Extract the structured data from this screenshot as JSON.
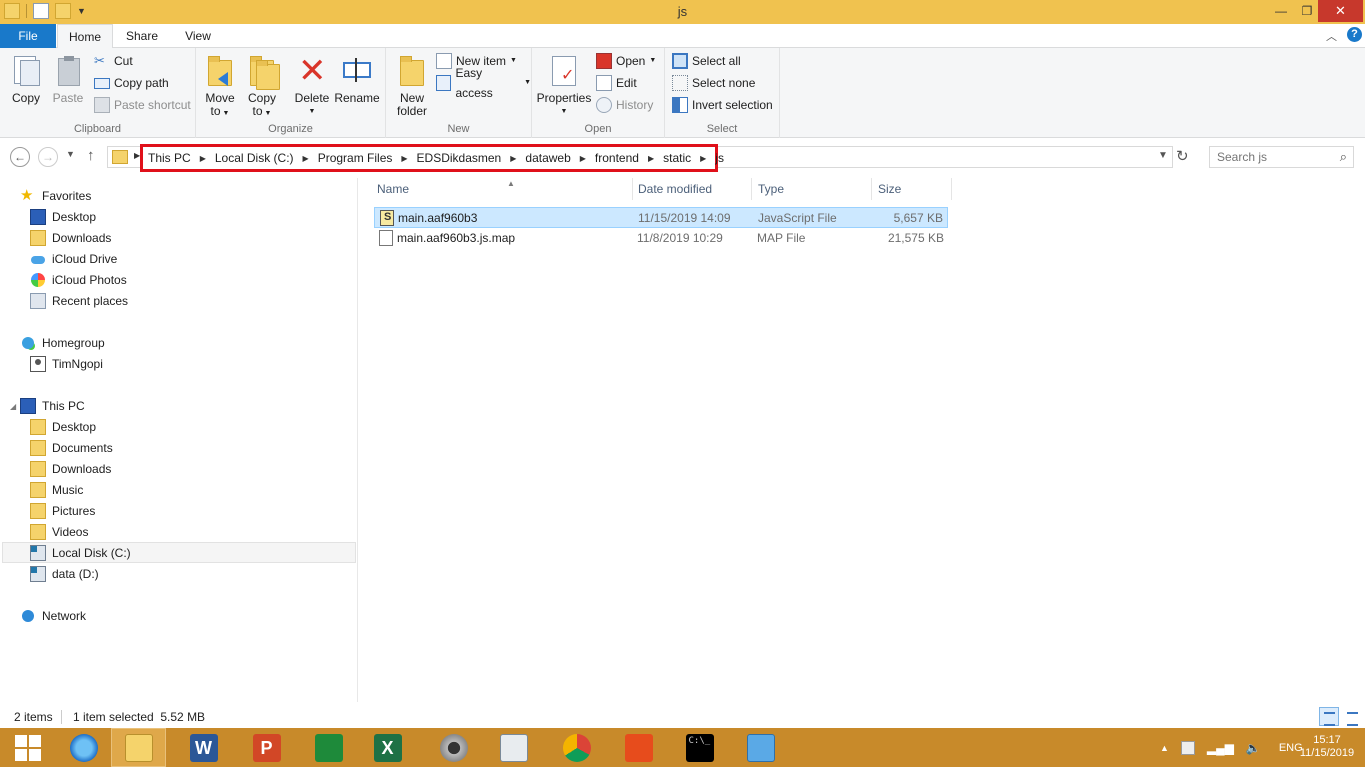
{
  "window": {
    "title": "js"
  },
  "ribbon": {
    "tabs": [
      "File",
      "Home",
      "Share",
      "View"
    ],
    "clipboard": {
      "label": "Clipboard",
      "copy": "Copy",
      "paste": "Paste",
      "cut": "Cut",
      "copy_path": "Copy path",
      "paste_shortcut": "Paste shortcut"
    },
    "organize": {
      "label": "Organize",
      "move_to_1": "Move",
      "move_to_2": "to",
      "copy_to_1": "Copy",
      "copy_to_2": "to",
      "delete": "Delete",
      "rename": "Rename"
    },
    "new": {
      "label": "New",
      "new_folder_1": "New",
      "new_folder_2": "folder",
      "new_item": "New item",
      "easy_access": "Easy access"
    },
    "open": {
      "label": "Open",
      "properties": "Properties",
      "open": "Open",
      "edit": "Edit",
      "history": "History"
    },
    "select": {
      "label": "Select",
      "select_all": "Select all",
      "select_none": "Select none",
      "invert": "Invert selection"
    }
  },
  "address": {
    "crumbs": [
      "This PC",
      "Local Disk (C:)",
      "Program Files",
      "EDSDikdasmen",
      "dataweb",
      "frontend",
      "static",
      "js"
    ],
    "highlight_color": "#e0101a"
  },
  "search": {
    "placeholder": "Search js"
  },
  "navpane": {
    "favorites": "Favorites",
    "fav_items": [
      "Desktop",
      "Downloads",
      "iCloud Drive",
      "iCloud Photos",
      "Recent places"
    ],
    "homegroup": "Homegroup",
    "home_items": [
      "TimNgopi"
    ],
    "thispc": "This PC",
    "pc_items": [
      "Desktop",
      "Documents",
      "Downloads",
      "Music",
      "Pictures",
      "Videos",
      "Local Disk (C:)",
      "data (D:)"
    ],
    "network": "Network"
  },
  "columns": {
    "name": "Name",
    "date": "Date modified",
    "type": "Type",
    "size": "Size"
  },
  "files": [
    {
      "name": "main.aaf960b3",
      "date": "11/15/2019 14:09",
      "type": "JavaScript File",
      "size": "5,657 KB",
      "selected": true
    },
    {
      "name": "main.aaf960b3.js.map",
      "date": "11/8/2019 10:29",
      "type": "MAP File",
      "size": "21,575 KB",
      "selected": false
    }
  ],
  "status": {
    "count": "2 items",
    "selection": "1 item selected  5.52 MB"
  },
  "taskbar": {
    "lang": "ENG",
    "time": "15:17",
    "date": "11/15/2019",
    "colors": {
      "bar": "#c88a2a",
      "titlebar": "#f0c24f"
    }
  }
}
